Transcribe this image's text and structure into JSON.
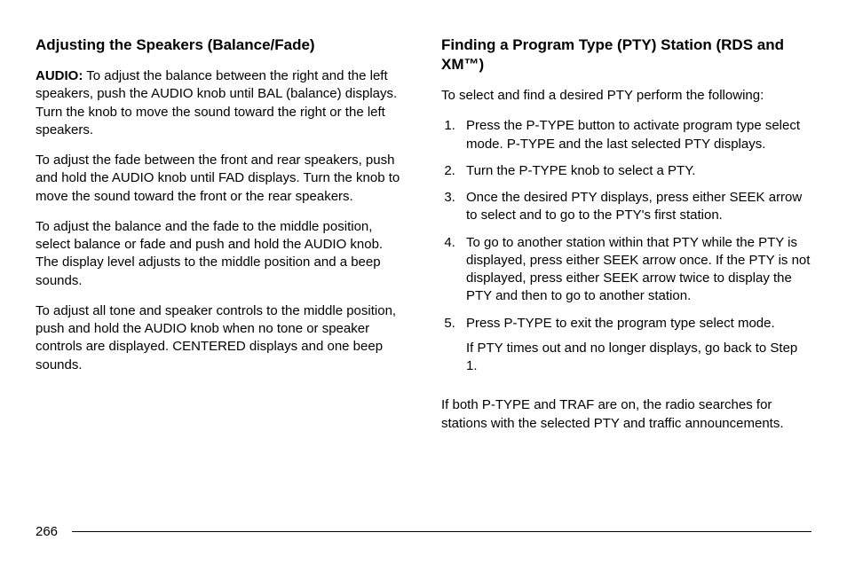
{
  "leftColumn": {
    "heading": "Adjusting the Speakers (Balance/Fade)",
    "audioLabel": "AUDIO:",
    "para1": "To adjust the balance between the right and the left speakers, push the AUDIO knob until BAL (balance) displays. Turn the knob to move the sound toward the right or the left speakers.",
    "para2": "To adjust the fade between the front and rear speakers, push and hold the AUDIO knob until FAD displays. Turn the knob to move the sound toward the front or the rear speakers.",
    "para3": "To adjust the balance and the fade to the middle position, select balance or fade and push and hold the AUDIO knob. The display level adjusts to the middle position and a beep sounds.",
    "para4": "To adjust all tone and speaker controls to the middle position, push and hold the AUDIO knob when no tone or speaker controls are displayed. CENTERED displays and one beep sounds."
  },
  "rightColumn": {
    "heading": "Finding a Program Type (PTY) Station (RDS and XM™)",
    "intro": "To select and find a desired PTY perform the following:",
    "steps": [
      "Press the P-TYPE button to activate program type select mode. P-TYPE and the last selected PTY displays.",
      "Turn the P-TYPE knob to select a PTY.",
      "Once the desired PTY displays, press either SEEK arrow to select and to go to the PTY's first station.",
      "To go to another station within that PTY while the PTY is displayed, press either SEEK arrow once. If the PTY is not displayed, press either SEEK arrow twice to display the PTY and then to go to another station.",
      "Press P-TYPE to exit the program type select mode."
    ],
    "step5Sub": "If PTY times out and no longer displays, go back to Step 1.",
    "outro": "If both P-TYPE and TRAF are on, the radio searches for stations with the selected PTY and traffic announcements."
  },
  "pageNumber": "266"
}
